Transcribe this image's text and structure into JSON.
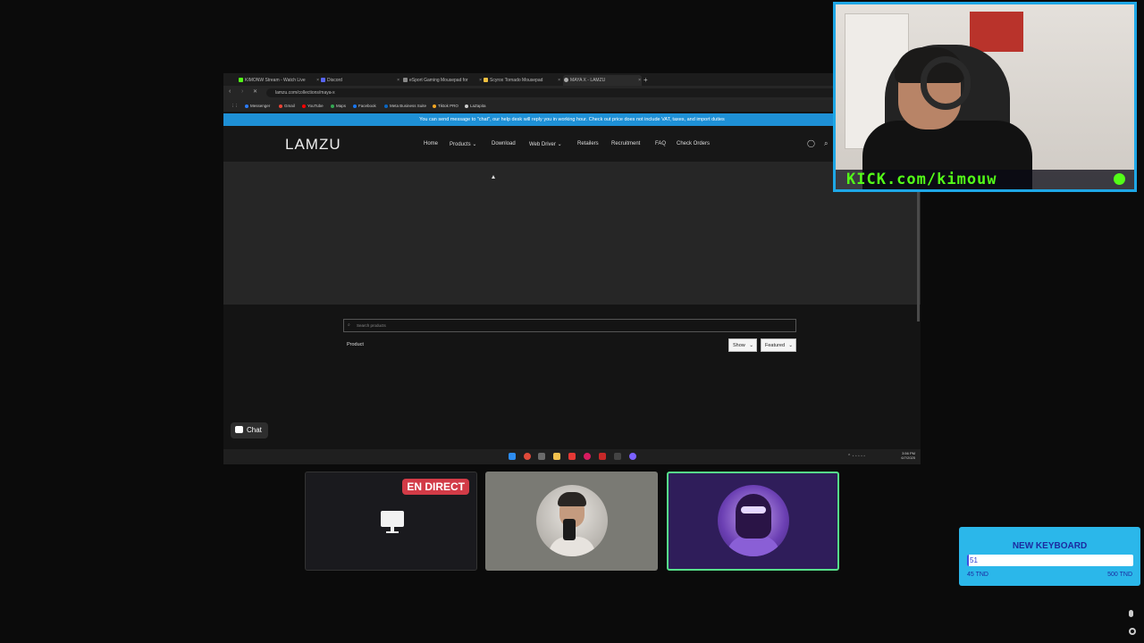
{
  "browser": {
    "tabs": [
      {
        "label": "KIMONW Stream - Watch Live",
        "color": "#53fc18"
      },
      {
        "label": "Discord",
        "color": "#5865f2"
      },
      {
        "label": "eSport Gaming Mousepad for",
        "color": "#888888"
      },
      {
        "label": "Scyrox Tornado Mousepad",
        "color": "#f0c040"
      },
      {
        "label": "MAYA X - LAMZU",
        "color": "#aaaaaa"
      }
    ],
    "url": "lamzu.com/collections/maya-x",
    "bookmarks": [
      "Messenger",
      "Gmail",
      "YouTube",
      "Maps",
      "Facebook",
      "Meta Business Suite",
      "Tiktok PRO",
      "LaZapita"
    ]
  },
  "site": {
    "announcement": "You can send message to \"chat\", our help desk will reply you in working hour. Check out price does not include VAT, taxes, and import duties",
    "logo": "LAMZU",
    "nav": [
      "Home",
      "Products",
      "Download",
      "Web Driver",
      "Retailers",
      "Recruitment",
      "FAQ",
      "Check Orders"
    ],
    "search_placeholder": "Search products",
    "product_label": "Product",
    "show_select": "Show",
    "sort_select": "Featured",
    "chat_label": "Chat"
  },
  "taskbar": {
    "time": "3:56 PM",
    "date": "6/7/2025"
  },
  "webcam": {
    "banner": "KICK.com/kimouw"
  },
  "tiles": {
    "live_badge": "EN DIRECT"
  },
  "goal": {
    "title": "NEW KEYBOARD",
    "current": "51",
    "min": "45 TND",
    "max": "500 TND",
    "progress": 0.01
  }
}
